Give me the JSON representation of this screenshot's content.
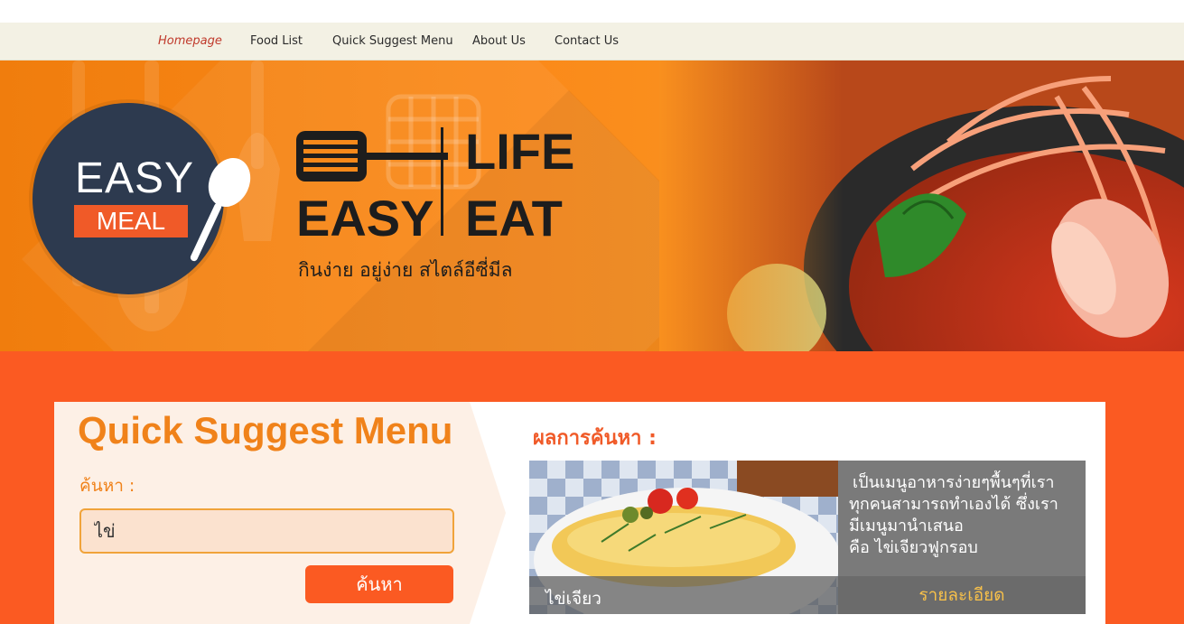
{
  "nav": {
    "items": [
      {
        "label": "Homepage",
        "active": true
      },
      {
        "label": "Food List",
        "active": false
      },
      {
        "label": "Quick Suggest Menu",
        "active": false
      },
      {
        "label": "About Us",
        "active": false
      },
      {
        "label": "Contact Us",
        "active": false
      }
    ]
  },
  "hero": {
    "logo": {
      "easy": "EASY",
      "meal": "MEAL"
    },
    "slogan": {
      "life": "LIFE",
      "easy": "EASY",
      "eat": "EAT"
    },
    "tagline": "กินง่าย   อยู่ง่าย   สไตล์อีซี่มีล"
  },
  "quick_suggest": {
    "title": "Quick Suggest Menu",
    "search_label": "ค้นหา :",
    "search_value": "ไข่",
    "search_button": "ค้นหา"
  },
  "results": {
    "title": "ผลการค้นหา :",
    "item": {
      "name": "ไข่เจียว",
      "description_lines": [
        "เป็นเมนูอาหารง่ายๆพื้นๆที่เรา",
        "ทุกคนสามารถทำเองได้ ซึ่งเรา",
        "มีเมนูมานำเสนอ",
        "คือ ไข่เจียวฟูกรอบ"
      ],
      "details_label": "รายละเอียด"
    }
  },
  "colors": {
    "nav_bg": "#f3f1e4",
    "hero_orange": "#f7891a",
    "section_bg": "#fb5a22",
    "title_orange": "#f0821a",
    "logo_navy": "#2d3a4f",
    "details_gold": "#f7c04a"
  }
}
